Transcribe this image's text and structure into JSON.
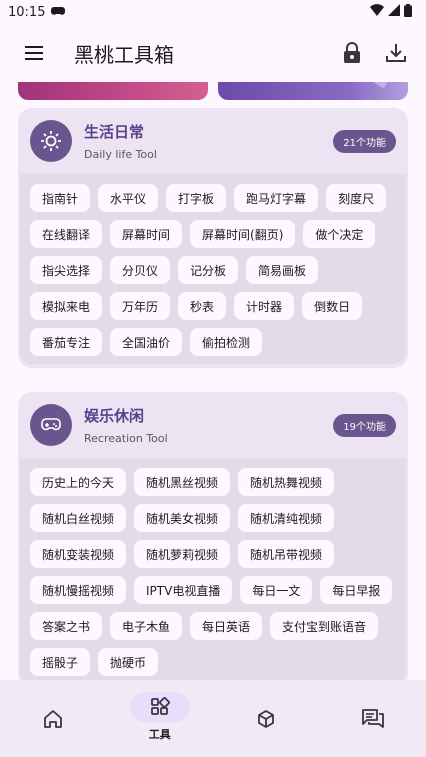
{
  "status_bar": {
    "time": "10:15"
  },
  "app_bar": {
    "title": "黑桃工具箱",
    "icons": [
      "menu-icon",
      "lock-icon",
      "download-icon"
    ]
  },
  "categories": [
    {
      "title": "生活日常",
      "subtitle": "Daily life Tool",
      "count_label": "21个功能",
      "icon": "sun-icon",
      "tools": [
        "指南针",
        "水平仪",
        "打字板",
        "跑马灯字幕",
        "刻度尺",
        "在线翻译",
        "屏幕时间",
        "屏幕时间(翻页)",
        "做个决定",
        "指尖选择",
        "分贝仪",
        "记分板",
        "简易画板",
        "模拟来电",
        "万年历",
        "秒表",
        "计时器",
        "倒数日",
        "番茄专注",
        "全国油价",
        "偷拍检测"
      ]
    },
    {
      "title": "娱乐休闲",
      "subtitle": "Recreation Tool",
      "count_label": "19个功能",
      "icon": "gamepad-icon",
      "tools": [
        "历史上的今天",
        "随机黑丝视频",
        "随机热舞视频",
        "随机白丝视频",
        "随机美女视频",
        "随机清纯视频",
        "随机变装视频",
        "随机萝莉视频",
        "随机吊带视频",
        "随机慢摇视频",
        "IPTV电视直播",
        "每日一文",
        "每日早报",
        "答案之书",
        "电子木鱼",
        "每日英语",
        "支付宝到账语音",
        "摇骰子",
        "抛硬币"
      ]
    }
  ],
  "bottom_nav": {
    "items": [
      {
        "icon": "home-icon",
        "label": ""
      },
      {
        "icon": "tools-grid-icon",
        "label": "工具"
      },
      {
        "icon": "cube-icon",
        "label": ""
      },
      {
        "icon": "chat-icon",
        "label": ""
      }
    ],
    "active_index": 1
  }
}
